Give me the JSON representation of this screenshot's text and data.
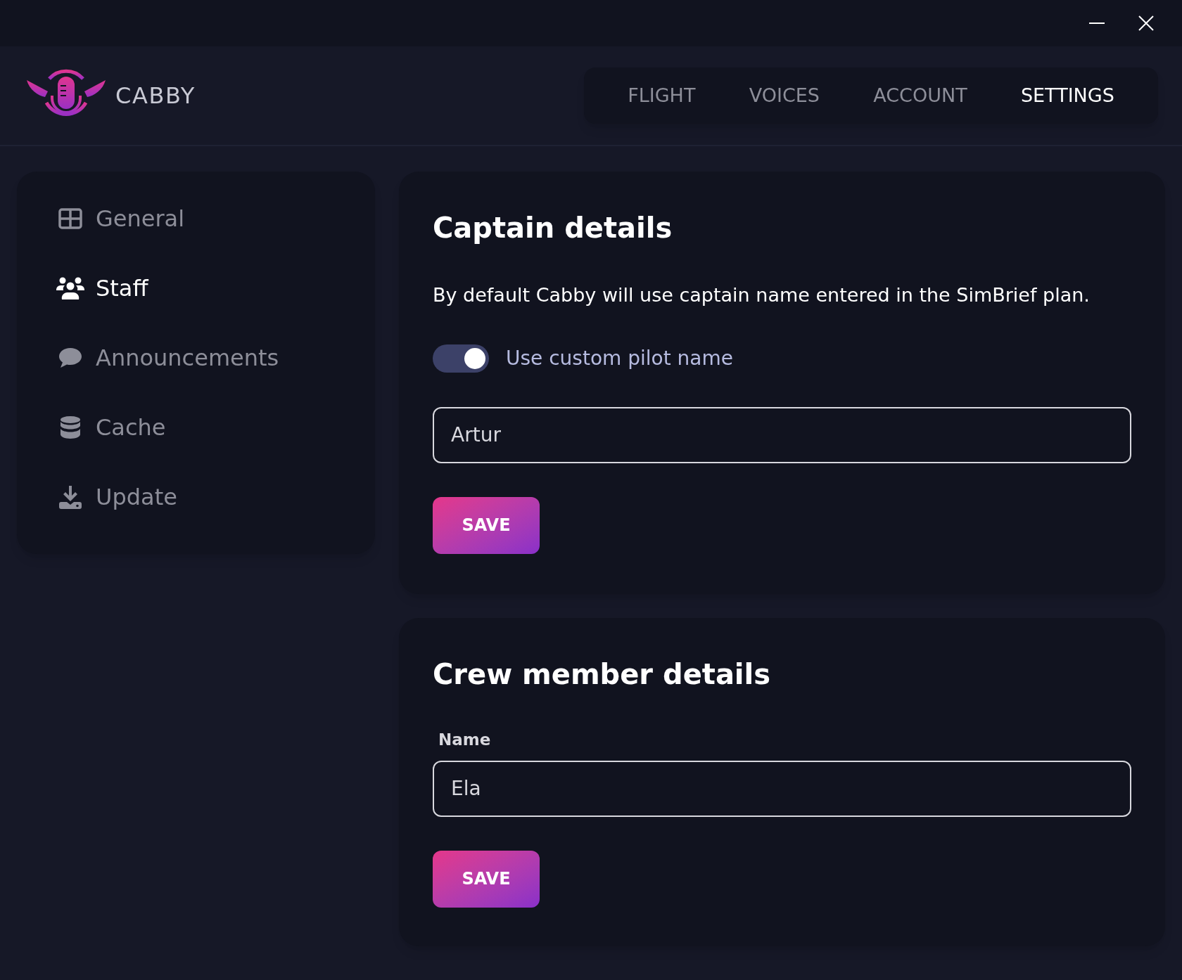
{
  "brand": {
    "name": "CABBY"
  },
  "nav": [
    {
      "label": "FLIGHT",
      "selected": false
    },
    {
      "label": "VOICES",
      "selected": false
    },
    {
      "label": "ACCOUNT",
      "selected": false
    },
    {
      "label": "SETTINGS",
      "selected": true
    }
  ],
  "sidebar": {
    "items": [
      {
        "label": "General",
        "kind": "grid",
        "selected": false
      },
      {
        "label": "Staff",
        "kind": "users",
        "selected": true
      },
      {
        "label": "Announcements",
        "kind": "chat",
        "selected": false
      },
      {
        "label": "Cache",
        "kind": "database",
        "selected": false
      },
      {
        "label": "Update",
        "kind": "download",
        "selected": false
      }
    ]
  },
  "captain": {
    "title": "Captain details",
    "description": "By default Cabby will use captain name entered in the SimBrief plan.",
    "toggle": {
      "label": "Use custom pilot name",
      "on": true
    },
    "name_value": "Artur",
    "button": "SAVE"
  },
  "crew": {
    "title": "Crew member details",
    "field_label": "Name",
    "name_value": "Ela",
    "button": "SAVE"
  }
}
